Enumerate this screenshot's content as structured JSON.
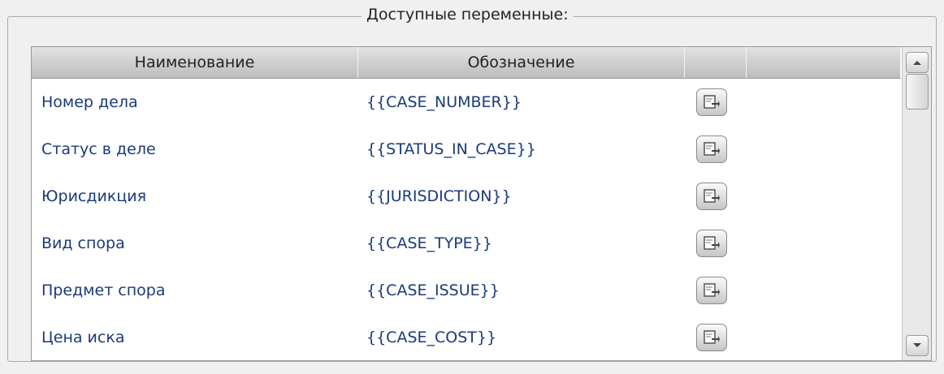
{
  "groupbox": {
    "legend": "Доступные переменные:"
  },
  "grid": {
    "columns": [
      "Наименование",
      "Обозначение",
      "",
      ""
    ],
    "rows": [
      {
        "name": "Номер дела",
        "code": "{{CASE_NUMBER}}"
      },
      {
        "name": "Статус в деле",
        "code": "{{STATUS_IN_CASE}}"
      },
      {
        "name": "Юрисдикция",
        "code": "{{JURISDICTION}}"
      },
      {
        "name": "Вид спора",
        "code": "{{CASE_TYPE}}"
      },
      {
        "name": "Предмет спора",
        "code": "{{CASE_ISSUE}}"
      },
      {
        "name": "Цена иска",
        "code": "{{CASE_COST}}"
      }
    ],
    "row_button_icon": "insert-icon"
  },
  "scrollbar": {
    "up_icon": "arrow-up-icon",
    "down_icon": "arrow-down-icon"
  }
}
